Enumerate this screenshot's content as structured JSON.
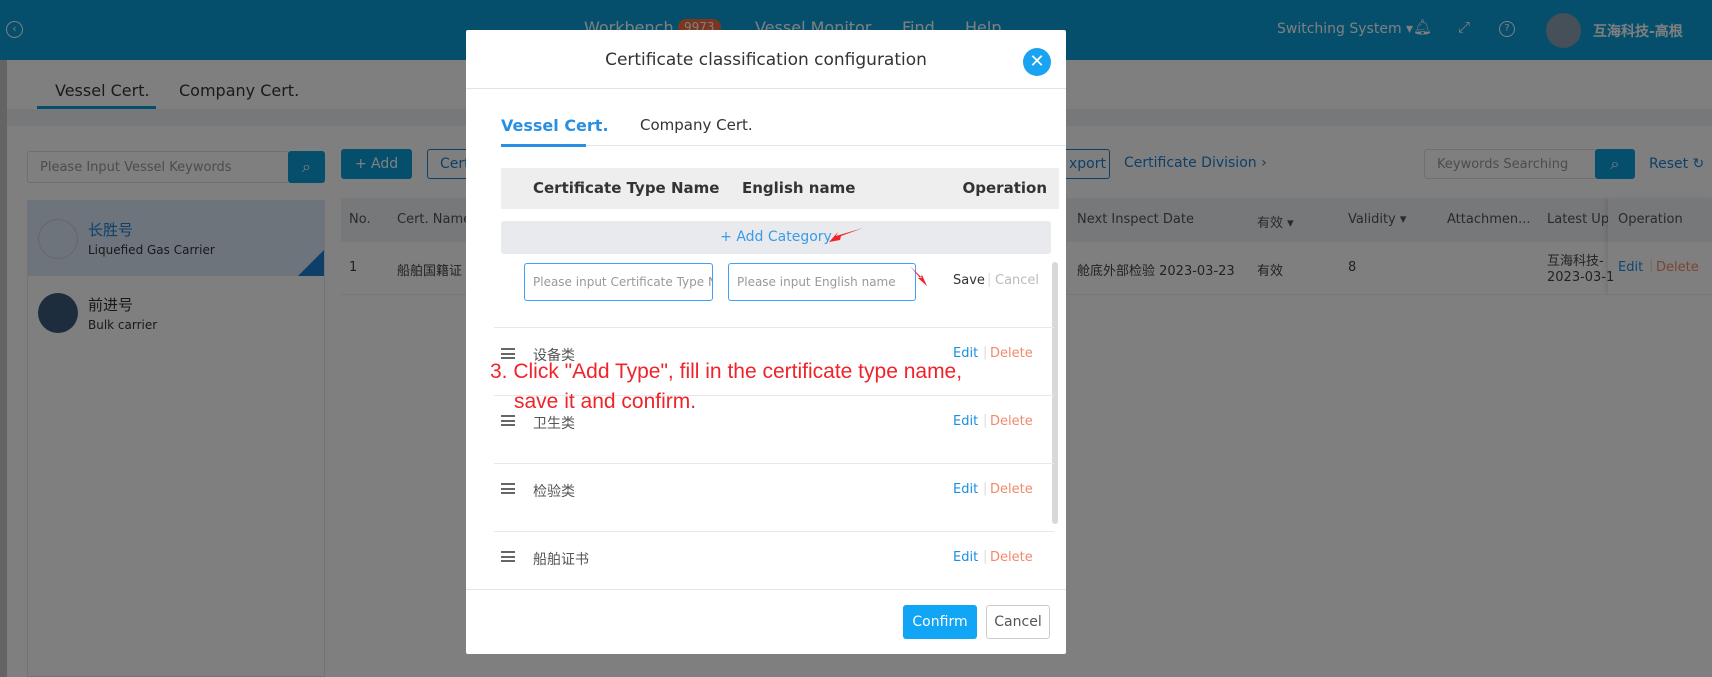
{
  "topbar": {
    "nav": [
      "Workbench",
      "Vessel Monitor",
      "Find",
      "Help"
    ],
    "badge": "9973",
    "switch_system": "Switching System ▾",
    "user": "互海科技-高根",
    "accent": "#0b9edb"
  },
  "page": {
    "tabs": [
      "Vessel Cert.",
      "Company Cert."
    ],
    "vessel_search_placeholder": "Please Input Vessel Keywords",
    "vessels": [
      {
        "name": "长胜号",
        "type": "Liquefied Gas Carrier"
      },
      {
        "name": "前进号",
        "type": "Bulk carrier"
      }
    ],
    "toolbar": {
      "add": "+ Add",
      "cert": "Cert",
      "export": "xport",
      "division": "Certificate Division ›",
      "keywords_placeholder": "Keywords Searching",
      "reset": "Reset ↻"
    },
    "columns": [
      "No.",
      "Cert. Name",
      "Next Inspect Date",
      "有效 ▾",
      "Validity ▾",
      "Attachmen...",
      "Latest Upd",
      "Operation"
    ],
    "row": {
      "no": "1",
      "name": "船舶国籍证",
      "next": "舱底外部检验 2023-03-23",
      "status": "有效",
      "validity": "8",
      "updater": "互海科技-",
      "updated": "2023-03-1",
      "edit": "Edit",
      "delete": "Delete"
    }
  },
  "modal": {
    "title": "Certificate classification configuration",
    "tabs": [
      "Vessel Cert.",
      "Company Cert."
    ],
    "headers": [
      "Certificate Type Name",
      "English name",
      "Operation"
    ],
    "add_category": "+ Add Category",
    "type_placeholder": "Please input Certificate Type N",
    "english_placeholder": "Please input English name",
    "save": "Save",
    "cancel_inline": "Cancel",
    "categories": [
      "设备类",
      "卫生类",
      "检验类",
      "船舶证书"
    ],
    "edit": "Edit",
    "delete": "Delete",
    "confirm": "Confirm",
    "cancel": "Cancel"
  },
  "annotation": {
    "line1": "3. Click \"Add Type\", fill in the certificate type name,",
    "line2": "save it and confirm.",
    "color": "#f0232a"
  }
}
